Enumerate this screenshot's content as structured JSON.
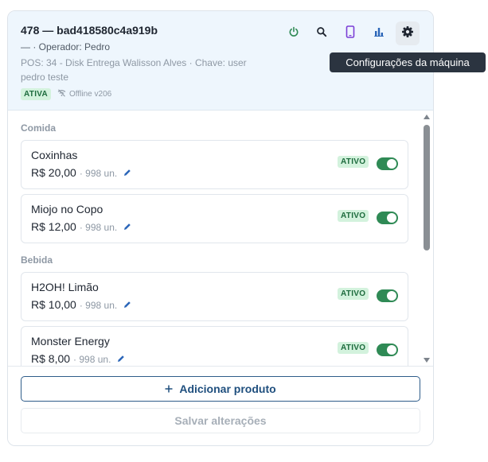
{
  "machine": {
    "title": "478 — bad418580c4a919b",
    "operator": "— · Operador: Pedro",
    "pos": "POS: 34 - Disk Entrega Walisson Alves · Chave: user pedro teste",
    "status_badge": "ATIVA",
    "connection": "Offline v206"
  },
  "toolbar": {
    "icons": [
      "power-icon",
      "search-icon",
      "phone-icon",
      "bar-chart-icon",
      "gear-icon"
    ],
    "colors": {
      "power": "#2f8a55",
      "search": "#1e2530",
      "phone": "#7b3fd6",
      "chart": "#2b66b8",
      "gear": "#1e2530"
    },
    "tooltip": "Configurações da máquina"
  },
  "sections": [
    {
      "label": "Comida",
      "items": [
        {
          "name": "Coxinhas",
          "price": "R$ 20,00",
          "units": "· 998 un.",
          "badge": "ATIVO",
          "enabled": true
        },
        {
          "name": "Miojo no Copo",
          "price": "R$ 12,00",
          "units": "· 998 un.",
          "badge": "ATIVO",
          "enabled": true
        }
      ]
    },
    {
      "label": "Bebida",
      "items": [
        {
          "name": "H2OH! Limão",
          "price": "R$ 10,00",
          "units": "· 998 un.",
          "badge": "ATIVO",
          "enabled": true
        },
        {
          "name": "Monster Energy",
          "price": "R$ 8,00",
          "units": "· 998 un.",
          "badge": "ATIVO",
          "enabled": true
        }
      ]
    }
  ],
  "footer": {
    "add_label": "Adicionar produto",
    "save_label": "Salvar alterações"
  }
}
